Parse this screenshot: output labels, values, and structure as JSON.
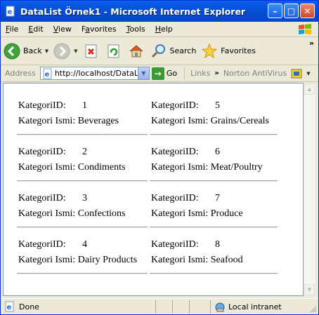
{
  "window": {
    "title": "DataList Örnek1 - Microsoft Internet Explorer",
    "minimize_glyph": "–",
    "maximize_glyph": "□",
    "close_glyph": "✕"
  },
  "menu": [
    {
      "label": "File",
      "accel": "F",
      "rest": "ile"
    },
    {
      "label": "Edit",
      "accel": "E",
      "rest": "dit"
    },
    {
      "label": "View",
      "accel": "V",
      "rest": "iew"
    },
    {
      "label": "Favorites",
      "accel": "a",
      "pre": "F",
      "rest": "vorites"
    },
    {
      "label": "Tools",
      "accel": "T",
      "rest": "ools"
    },
    {
      "label": "Help",
      "accel": "H",
      "rest": "elp"
    }
  ],
  "toolbar": {
    "back_label": "Back",
    "search_label": "Search",
    "favorites_label": "Favorites",
    "overflow": "»"
  },
  "addressbar": {
    "label": "Address",
    "url": "http://localhost/DataList",
    "go_label": "Go",
    "links_label": "Links",
    "links_chevron": "»",
    "norton_label": "Norton AntiVirus"
  },
  "datalist": {
    "id_label": "KategoriID:",
    "name_label": "Kategori Ismi:",
    "items": [
      {
        "id": "1",
        "name": "Beverages"
      },
      {
        "id": "5",
        "name": "Grains/Cereals"
      },
      {
        "id": "2",
        "name": "Condiments"
      },
      {
        "id": "6",
        "name": "Meat/Poultry"
      },
      {
        "id": "3",
        "name": "Confections"
      },
      {
        "id": "7",
        "name": "Produce"
      },
      {
        "id": "4",
        "name": "Dairy Products"
      },
      {
        "id": "8",
        "name": "Seafood"
      }
    ]
  },
  "statusbar": {
    "status_text": "Done",
    "zone_text": "Local intranet"
  },
  "colors": {
    "titlebar": "#0451d9",
    "chrome": "#ece9d8",
    "content_bg": "#ffffff"
  }
}
